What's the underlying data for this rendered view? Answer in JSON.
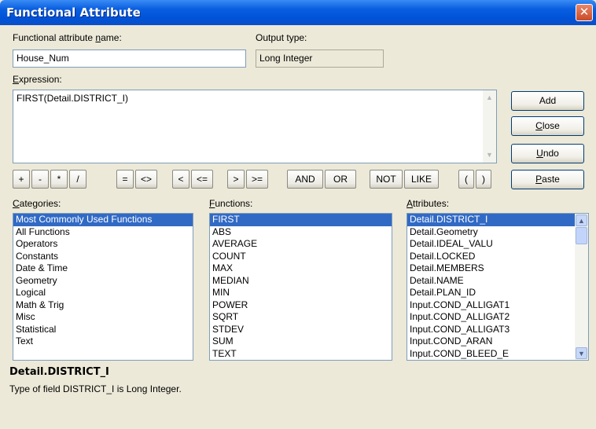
{
  "window": {
    "title": "Functional Attribute",
    "close_glyph": "✕"
  },
  "name_field": {
    "label_pre": "Functional attribute ",
    "label_ul": "n",
    "label_post": "ame:",
    "value": "House_Num"
  },
  "output_type": {
    "label": "Output type:",
    "value": "Long Integer"
  },
  "expression": {
    "label_ul": "E",
    "label_post": "xpression:",
    "value": "FIRST(Detail.DISTRICT_I)"
  },
  "buttons": {
    "add": "Add",
    "close": {
      "ul": "C",
      "rest": "lose"
    },
    "undo": {
      "ul": "U",
      "rest": "ndo"
    },
    "paste": {
      "ul": "P",
      "rest": "aste"
    }
  },
  "operators": [
    "+",
    "-",
    "*",
    "/",
    "=",
    "<>",
    "<",
    "<=",
    ">",
    ">=",
    "AND",
    "OR",
    "NOT",
    "LIKE",
    "(",
    ")"
  ],
  "categories": {
    "label_ul": "C",
    "label_post": "ategories:",
    "items": [
      "Most Commonly Used Functions",
      "All Functions",
      "Operators",
      "Constants",
      "Date & Time",
      "Geometry",
      "Logical",
      "Math & Trig",
      "Misc",
      "Statistical",
      "Text"
    ],
    "selected": 0
  },
  "functions": {
    "label_ul": "F",
    "label_post": "unctions:",
    "items": [
      "FIRST",
      "ABS",
      "AVERAGE",
      "COUNT",
      "MAX",
      "MEDIAN",
      "MIN",
      "POWER",
      "SQRT",
      "STDEV",
      "SUM",
      "TEXT"
    ],
    "selected": 0
  },
  "attributes": {
    "label_ul": "A",
    "label_post": "ttributes:",
    "items": [
      "Detail.DISTRICT_I",
      "Detail.Geometry",
      "Detail.IDEAL_VALU",
      "Detail.LOCKED",
      "Detail.MEMBERS",
      "Detail.NAME",
      "Detail.PLAN_ID",
      "Input.COND_ALLIGAT1",
      "Input.COND_ALLIGAT2",
      "Input.COND_ALLIGAT3",
      "Input.COND_ARAN",
      "Input.COND_BLEED_E"
    ],
    "selected": 0
  },
  "description": {
    "title": "Detail.DISTRICT_I",
    "text": "Type of field DISTRICT_I is Long Integer."
  },
  "icons": {
    "scroll_up": "chevron-up-icon",
    "scroll_down": "chevron-down-icon",
    "close": "close-icon"
  }
}
